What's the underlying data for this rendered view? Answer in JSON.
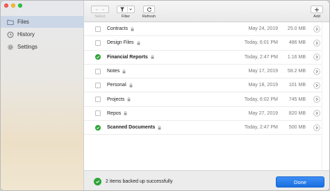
{
  "sidebar": {
    "items": [
      {
        "label": "Files",
        "icon": "folder-icon",
        "active": true
      },
      {
        "label": "History",
        "icon": "clock-icon",
        "active": false
      },
      {
        "label": "Settings",
        "icon": "gear-icon",
        "active": false
      }
    ]
  },
  "toolbar": {
    "select_label": "Select",
    "filter_label": "Filter",
    "refresh_label": "Refresh",
    "add_label": "Add"
  },
  "files": [
    {
      "name": "Contracts",
      "date": "May 24, 2019",
      "size": "25.0 MB",
      "checked": false,
      "bold": false
    },
    {
      "name": "Design Files",
      "date": "Today, 6:01 PM",
      "size": "486 MB",
      "checked": false,
      "bold": false
    },
    {
      "name": "Financial Reports",
      "date": "Today, 2:47 PM",
      "size": "1.16 MB",
      "checked": true,
      "bold": true
    },
    {
      "name": "Notes",
      "date": "May 17, 2019",
      "size": "58.2 MB",
      "checked": false,
      "bold": false
    },
    {
      "name": "Personal",
      "date": "May 18, 2019",
      "size": "101 MB",
      "checked": false,
      "bold": false
    },
    {
      "name": "Projects",
      "date": "Today, 6:02 PM",
      "size": "745 MB",
      "checked": false,
      "bold": false
    },
    {
      "name": "Repos",
      "date": "May 27, 2019",
      "size": "820 MB",
      "checked": false,
      "bold": false
    },
    {
      "name": "Scanned Documents",
      "date": "Today, 2:47 PM",
      "size": "500 MB",
      "checked": true,
      "bold": true
    }
  ],
  "footer": {
    "status": "2 items backed up successfully",
    "done_label": "Done"
  },
  "colors": {
    "accent": "#1a6fe0",
    "success": "#2ea33a",
    "sidebar_active": "#cbd6e7"
  }
}
